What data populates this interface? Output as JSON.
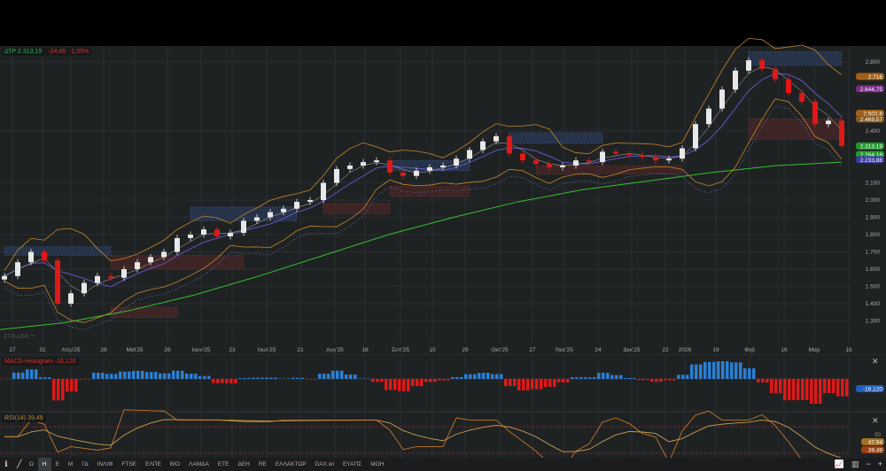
{
  "header": {
    "symbol": "ΔΤΡ",
    "price": "2.313,19",
    "change": "-24,45",
    "change_pct": "-1,05%"
  },
  "watermark": "ZTRADE™",
  "colors": {
    "up": "#e8e8e8",
    "down": "#e01818",
    "bollinger": "#c8862a",
    "sma200": "#38c030",
    "macd_pos": "#2a7fd4",
    "macd_neg": "#e01818",
    "rsi": "#d9822b",
    "rsi_avg": "#c8a050",
    "demand_zone": "#2a3a5a",
    "supply_zone": "#4a2626"
  },
  "chart_data": {
    "type": "candlestick",
    "closes": [
      1560,
      1640,
      1700,
      1650,
      1400,
      1460,
      1520,
      1560,
      1550,
      1600,
      1640,
      1670,
      1700,
      1780,
      1800,
      1830,
      1790,
      1810,
      1880,
      1900,
      1930,
      1950,
      1990,
      2000,
      2100,
      2180,
      2200,
      2220,
      2230,
      2160,
      2140,
      2170,
      2190,
      2200,
      2240,
      2290,
      2340,
      2370,
      2270,
      2230,
      2210,
      2190,
      2200,
      2230,
      2220,
      2280,
      2270,
      2260,
      2250,
      2230,
      2240,
      2300,
      2440,
      2530,
      2640,
      2750,
      2810,
      2760,
      2700,
      2620,
      2570,
      2440,
      2460,
      2313
    ],
    "long_ma": [
      1250,
      1290,
      1360,
      1450,
      1560,
      1680,
      1800,
      1900,
      1990,
      2060,
      2110,
      2160,
      2200,
      2220
    ],
    "zones": [
      {
        "type": "demand",
        "from": 0,
        "to": 8,
        "low": 1680,
        "high": 1730
      },
      {
        "type": "supply",
        "from": 8,
        "to": 13,
        "low": 1320,
        "high": 1380
      },
      {
        "type": "supply",
        "from": 8,
        "to": 18,
        "low": 1600,
        "high": 1680
      },
      {
        "type": "demand",
        "from": 14,
        "to": 22,
        "low": 1880,
        "high": 1960
      },
      {
        "type": "supply",
        "from": 24,
        "to": 29,
        "low": 1920,
        "high": 1980
      },
      {
        "type": "demand",
        "from": 29,
        "to": 35,
        "low": 2170,
        "high": 2230
      },
      {
        "type": "supply",
        "from": 29,
        "to": 35,
        "low": 2020,
        "high": 2080
      },
      {
        "type": "demand",
        "from": 38,
        "to": 45,
        "low": 2330,
        "high": 2390
      },
      {
        "type": "supply",
        "from": 40,
        "to": 51,
        "low": 2150,
        "high": 2200
      },
      {
        "type": "demand",
        "from": 56,
        "to": 63,
        "low": 2780,
        "high": 2860
      },
      {
        "type": "supply",
        "from": 56,
        "to": 63,
        "low": 2350,
        "high": 2470
      }
    ],
    "y_ticks": [
      2800,
      2400,
      2100,
      2000,
      1900,
      1800,
      1700,
      1600,
      1500,
      1400,
      1300
    ],
    "y_tick_labels": [
      "2.800",
      "2.400",
      "2.100",
      "2.000",
      "1.900",
      "1.800",
      "1.700",
      "1.600",
      "1.500",
      "1.400",
      "1.300"
    ],
    "price_tags": [
      {
        "value": 2716,
        "label": "2.716",
        "color": "#a0601a"
      },
      {
        "value": 2644.75,
        "label": "2.644,75",
        "color": "#7a2a8a"
      },
      {
        "value": 2502.8,
        "label": "2.502,8",
        "color": "#a0601a"
      },
      {
        "value": 2469.57,
        "label": "2.469,57",
        "color": "#8a5a20"
      },
      {
        "value": 2313.19,
        "label": "2.313,19",
        "color": "#1f9a2a"
      },
      {
        "value": 2264.18,
        "label": "2.264,18",
        "color": "#1f9a2a"
      },
      {
        "value": 2233.88,
        "label": "2.233,88",
        "color": "#3a3aa0"
      }
    ],
    "x_labels": [
      "17",
      "31",
      "Απρ'25",
      "28",
      "Μαϊ'25",
      "26",
      "Ιουν'25",
      "23",
      "Ιουλ'25",
      "21",
      "Αυγ'25",
      "18",
      "Σεπ'25",
      "15",
      "29",
      "Οκτ'25",
      "27",
      "Νοε'25",
      "24",
      "Δεκ'25",
      "22",
      "2026",
      "19",
      "Φεβ",
      "16",
      "Μαρ",
      "16"
    ]
  },
  "macd": {
    "label": "MACD-Histogram",
    "value": "-16,120"
  },
  "rsi": {
    "label": "RSI(14)",
    "value": "39,49",
    "avg": "47,94",
    "level": "50"
  },
  "toolbar": {
    "items": [
      "Ω",
      "Η",
      "Ε",
      "Μ",
      "ΓΔ",
      "ΙΝΛΙΦ",
      "FTSE",
      "ΕΛΠΕ",
      "ΒΙΟ",
      "ΛΑΜΔΑ",
      "ΕΤΕ",
      "ΔΕΗ",
      "RE",
      "ΕΛΛΑΚΤΩΡ",
      "DAX.wi",
      "ΕΥΑΠΣ",
      "ΜΟΗ"
    ],
    "active": "Η"
  }
}
